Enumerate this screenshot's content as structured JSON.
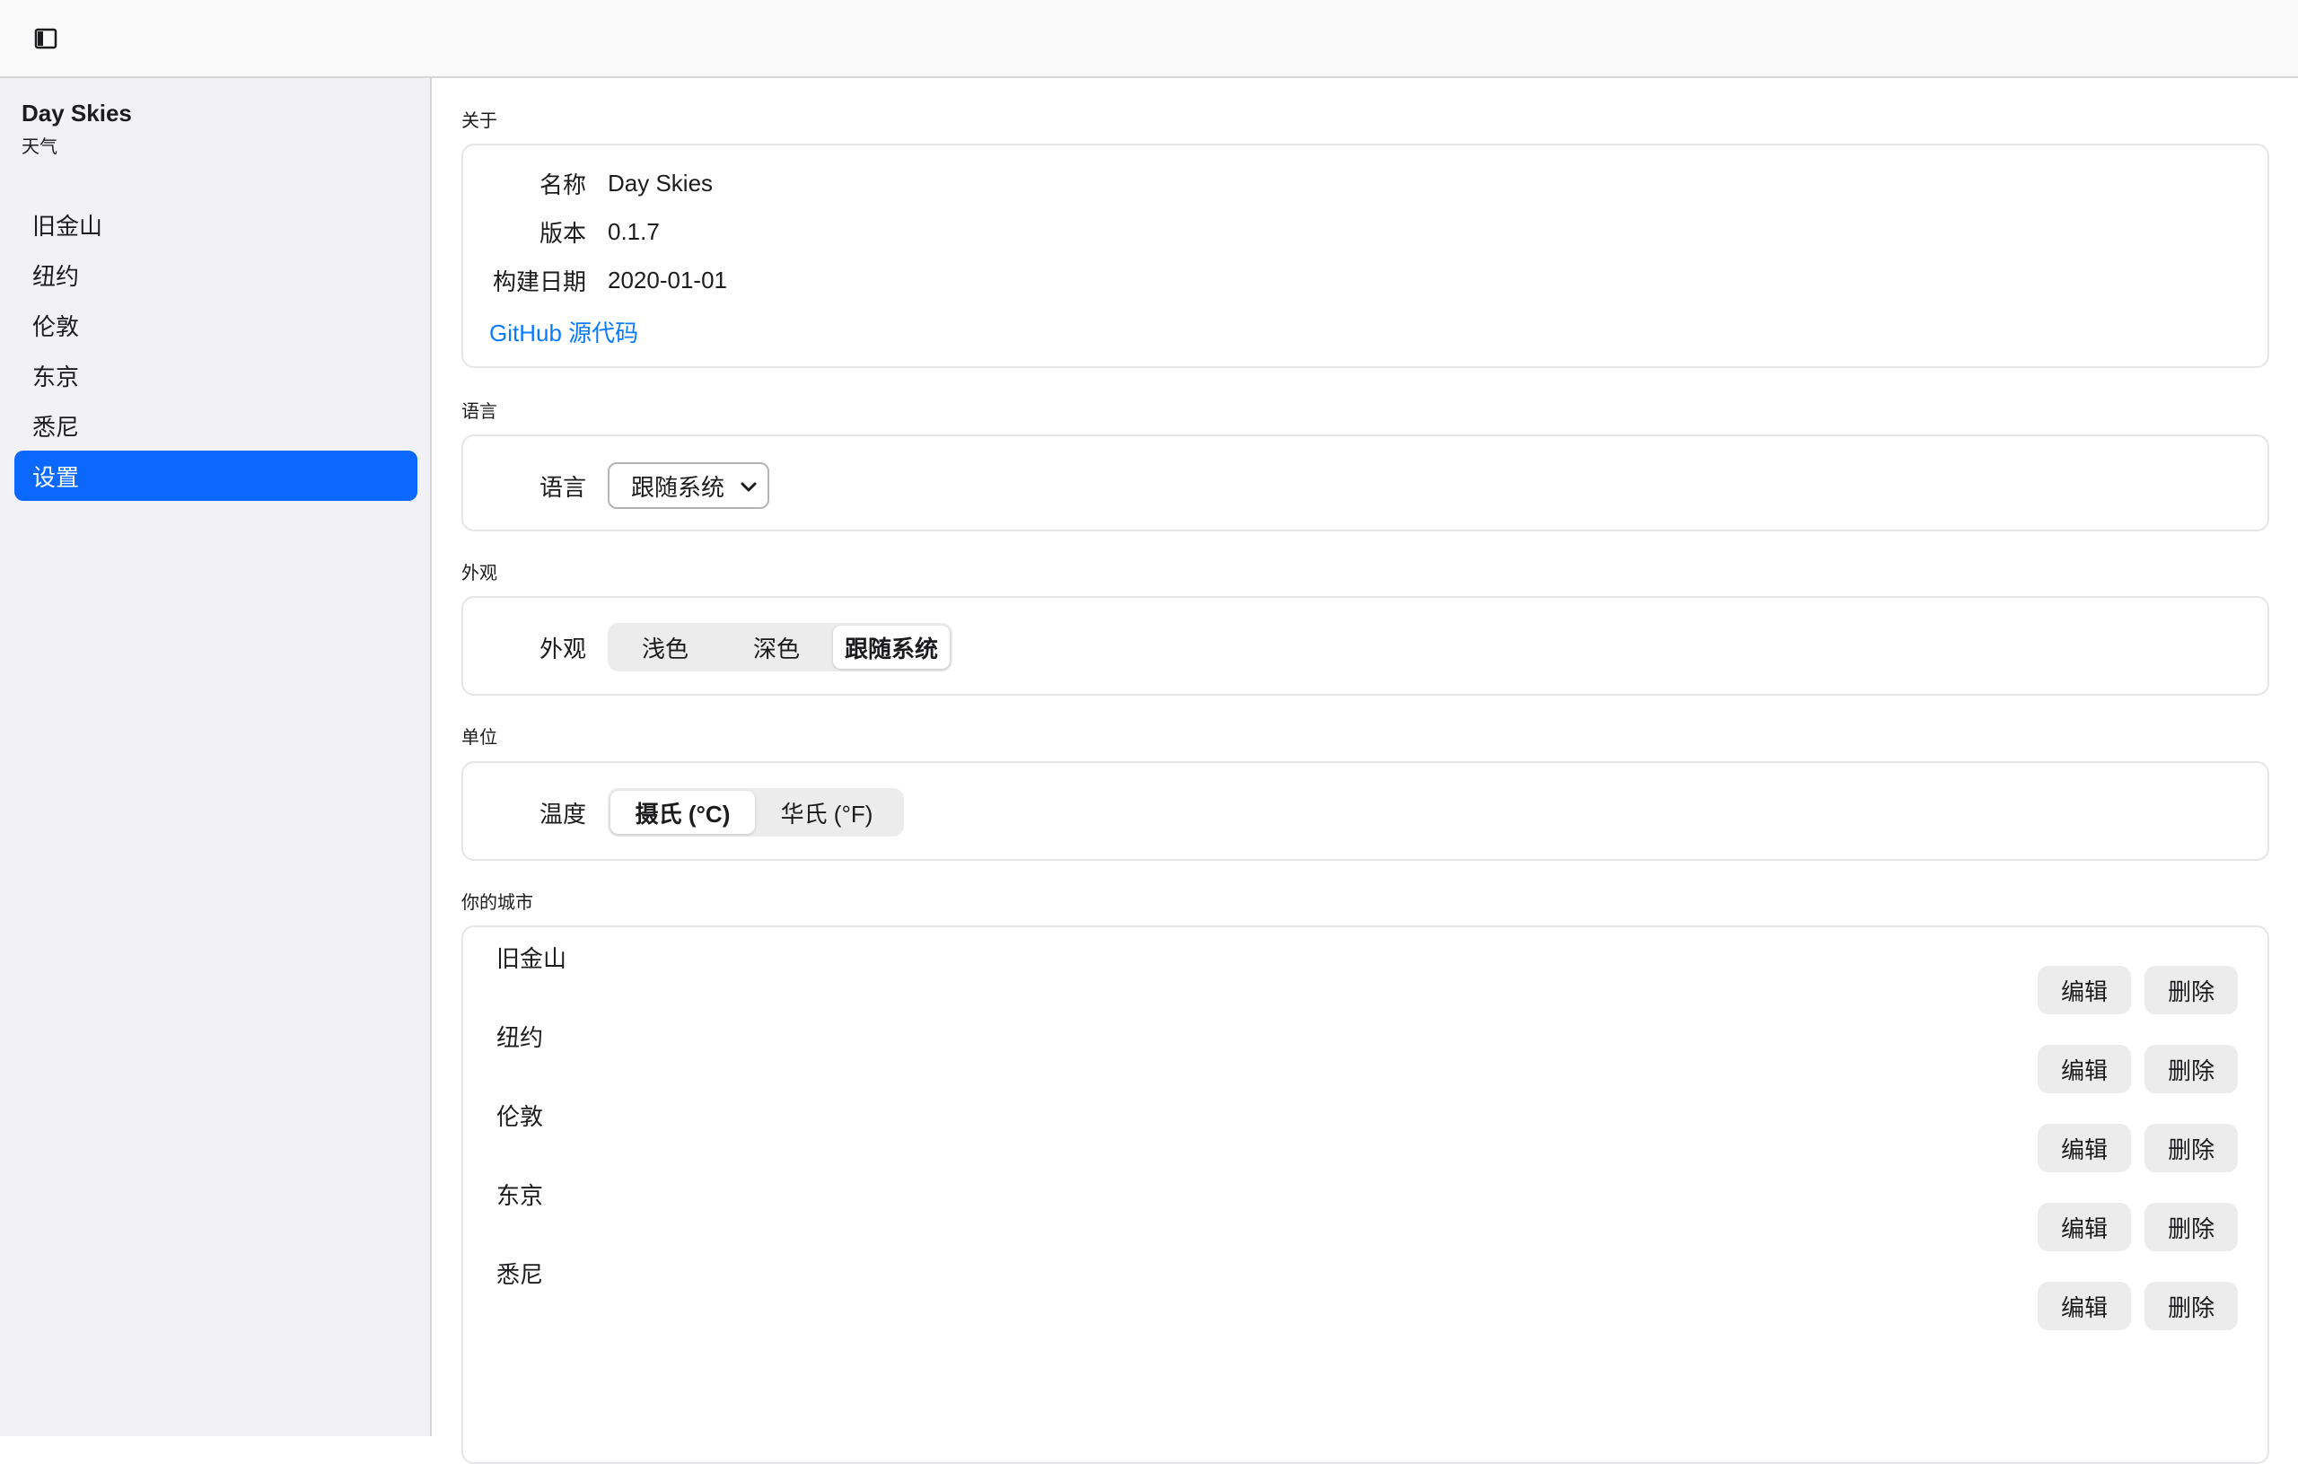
{
  "app": {
    "title": "Day Skies",
    "subtitle": "天气"
  },
  "sidebar": {
    "items": [
      {
        "label": "旧金山"
      },
      {
        "label": "纽约"
      },
      {
        "label": "伦敦"
      },
      {
        "label": "东京"
      },
      {
        "label": "悉尼"
      },
      {
        "label": "设置",
        "active": true
      }
    ]
  },
  "about": {
    "title": "关于",
    "name_label": "名称",
    "name_value": "Day Skies",
    "version_label": "版本",
    "version_value": "0.1.7",
    "build_label": "构建日期",
    "build_value": "2020-01-01",
    "source_link": "GitHub 源代码"
  },
  "language": {
    "title": "语言",
    "label": "语言",
    "selected": "跟随系统"
  },
  "appearance": {
    "title": "外观",
    "label": "外观",
    "options": [
      "浅色",
      "深色",
      "跟随系统"
    ],
    "selected": "跟随系统"
  },
  "units": {
    "title": "单位",
    "temp_label": "温度",
    "options": [
      "摄氏 (°C)",
      "华氏 (°F)"
    ],
    "selected": "摄氏 (°C)"
  },
  "cities": {
    "title": "你的城市",
    "items": [
      {
        "name": "旧金山"
      },
      {
        "name": "纽约"
      },
      {
        "name": "伦敦"
      },
      {
        "name": "东京"
      },
      {
        "name": "悉尼"
      }
    ],
    "edit_label": "编辑",
    "delete_label": "删除"
  },
  "colors": {
    "accent": "#0a68ff",
    "link": "#0a7aff"
  },
  "icons": {
    "toolbar": "sidebar-toggle-icon",
    "select": "chevron-down-icon"
  }
}
